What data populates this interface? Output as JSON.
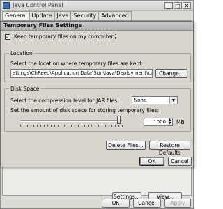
{
  "background_window": {
    "title": "Java Control Panel",
    "tabs": [
      "General",
      "Update",
      "Java",
      "Security",
      "Advanced"
    ],
    "buttons": {
      "settings": "Settings...",
      "view": "View..."
    },
    "footer": {
      "ok": "OK",
      "cancel": "Cancel",
      "apply": "Apply"
    },
    "window_controls": {
      "minimize": "_",
      "maximize": "□",
      "close": "✕"
    }
  },
  "dialog": {
    "title": "Temporary Files Settings",
    "keep_files": {
      "label": "Keep temporary files on my computer.",
      "checked": true,
      "check_glyph": "✓"
    },
    "location": {
      "legend": "Location",
      "prompt": "Select the location where temporary files are kept:",
      "path": "ettings\\ChReed\\Application Data\\Sun\\Java\\Deployment\\cache",
      "change_button": "Change..."
    },
    "disk_space": {
      "legend": "Disk Space",
      "compression_label": "Select the compression level for JAR files:",
      "compression_value": "None",
      "amount_label": "Set the amount of disk space for storing temporary files:",
      "amount_value": "1000",
      "unit": "MB",
      "slider_level": 0.97
    },
    "delete_button": "Delete Files...",
    "restore_button": "Restore Defaults",
    "ok_button": "OK",
    "cancel_button": "Cancel"
  }
}
